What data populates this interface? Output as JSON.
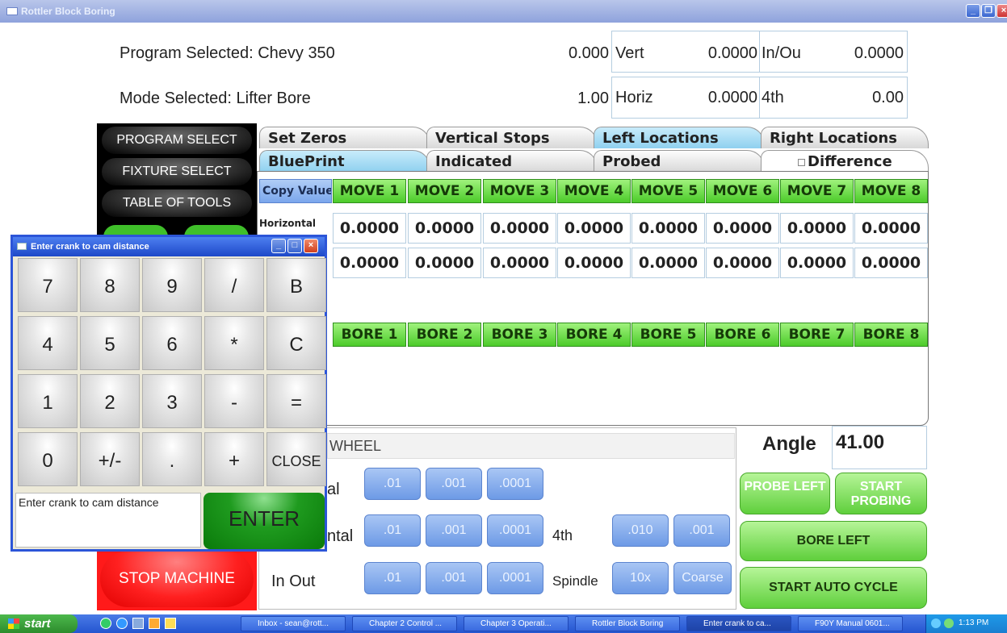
{
  "window": {
    "title": "Rottler Block Boring",
    "icon": "window-icon"
  },
  "header": {
    "program_label": "Program Selected: Chevy 350",
    "mode_label": "Mode Selected: Lifter Bore",
    "value_1": "0.000",
    "value_2": "1.00",
    "readouts": [
      {
        "label": "Vert",
        "value": "0.0000"
      },
      {
        "label": "In/Ou",
        "value": "0.0000"
      },
      {
        "label": "Horiz",
        "value": "0.0000"
      },
      {
        "label": "4th",
        "value": "0.00"
      }
    ]
  },
  "menu": {
    "items": [
      "PROGRAM SELECT",
      "FIXTURE SELECT",
      "TABLE OF TOOLS"
    ]
  },
  "tabs_row1": [
    "Set Zeros",
    "Vertical Stops",
    "Left Locations",
    "Right Locations"
  ],
  "tabs_row2": [
    "BluePrint",
    "Indicated",
    "Probed",
    "Difference"
  ],
  "grid": {
    "copy_label": "Copy Values",
    "move_buttons": [
      "MOVE 1",
      "MOVE 2",
      "MOVE 3",
      "MOVE 4",
      "MOVE 5",
      "MOVE 6",
      "MOVE 7",
      "MOVE 8"
    ],
    "row1_label": "Horizontal",
    "row1_values": [
      "0.0000",
      "0.0000",
      "0.0000",
      "0.0000",
      "0.0000",
      "0.0000",
      "0.0000",
      "0.0000"
    ],
    "row2_values": [
      "0.0000",
      "0.0000",
      "0.0000",
      "0.0000",
      "0.0000",
      "0.0000",
      "0.0000",
      "0.0000"
    ],
    "bore_buttons": [
      "BORE 1",
      "BORE 2",
      "BORE 3",
      "BORE 4",
      "BORE 5",
      "BORE 6",
      "BORE 7",
      "BORE 8"
    ]
  },
  "handwheel": {
    "title": "WHEEL",
    "row1_label": "al",
    "row2_label": "ntal",
    "row3_label": "In Out",
    "steps": [
      ".01",
      ".001",
      ".0001"
    ],
    "fourth_label": "4th",
    "fourth_steps": [
      ".010",
      ".001"
    ],
    "spindle_label": "Spindle",
    "spindle_steps": [
      "10x",
      "Coarse"
    ]
  },
  "angle": {
    "label": "Angle",
    "value": "41.00"
  },
  "actions": {
    "probe_left": "PROBE LEFT",
    "start_probing": "START PROBING",
    "bore_left": "BORE LEFT",
    "start_auto_cycle": "START AUTO CYCLE",
    "stop_machine": "STOP MACHINE"
  },
  "dialog": {
    "title": "Enter crank to cam distance",
    "keys": [
      "7",
      "8",
      "9",
      "/",
      "B",
      "4",
      "5",
      "6",
      "*",
      "C",
      "1",
      "2",
      "3",
      "-",
      "=",
      "0",
      "+/-",
      ".",
      "+",
      "CLOSE"
    ],
    "prompt": "Enter crank to cam distance",
    "enter_label": "ENTER"
  },
  "taskbar": {
    "start": "start",
    "tasks": [
      "Inbox - sean@rott...",
      "Chapter 2 Control ...",
      "Chapter 3 Operati...",
      "Rottler Block Boring",
      "Enter crank to ca...",
      "F90Y Manual 0601..."
    ],
    "clock": "1:13 PM"
  },
  "colors": {
    "green": "#5ccc36",
    "blue_tab": "#8fd0ef",
    "red": "#ff1a1a",
    "dialog_border": "#2c55d8"
  }
}
